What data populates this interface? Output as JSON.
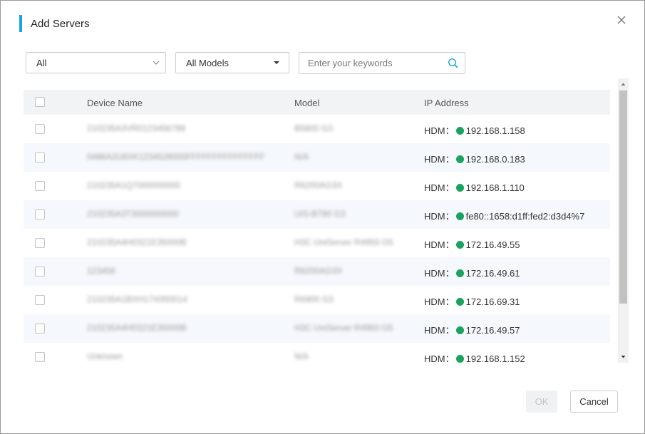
{
  "dialog": {
    "title": "Add Servers",
    "close_icon": "close-icon"
  },
  "filters": {
    "type_select": "All",
    "model_select": "All Models",
    "search_placeholder": "Enter your keywords",
    "search_value": ""
  },
  "table": {
    "headers": {
      "name": "Device Name",
      "model": "Model",
      "ip": "IP Address"
    },
    "rows": [
      {
        "name": "210235A3VR0123456789",
        "model": "B5800 G3",
        "ip_prefix": "HDM：",
        "ip": "192.168.1.158",
        "status": "green"
      },
      {
        "name": "0486A2U8XK1234528000FFFFFFFFFFFFFFF",
        "model": "N/A",
        "ip_prefix": "HDM：",
        "ip": "192.168.0.183",
        "status": "green"
      },
      {
        "name": "210235A1Q7000000000",
        "model": "R6200AG3X",
        "ip_prefix": "HDM：",
        "ip": "192.168.1.110",
        "status": "green"
      },
      {
        "name": "210235A3T3000000000",
        "model": "UIS-B790 G3",
        "ip_prefix": "HDM：",
        "ip": "fe80::1658:d1ff:fed2:d3d4%7",
        "status": "green"
      },
      {
        "name": "210235A4H0321E35000B",
        "model": "H3C UniServer R4950 G5",
        "ip_prefix": "HDM：",
        "ip": "172.16.49.55",
        "status": "green"
      },
      {
        "name": "123456",
        "model": "R6200AG3X",
        "ip_prefix": "HDM：",
        "ip": "172.16.49.61",
        "status": "green"
      },
      {
        "name": "210235A1BXH17X000014",
        "model": "R6900 G3",
        "ip_prefix": "HDM：",
        "ip": "172.16.69.31",
        "status": "green"
      },
      {
        "name": "210235A4H0321E35000B",
        "model": "H3C UniServer R4950 G5",
        "ip_prefix": "HDM：",
        "ip": "172.16.49.57",
        "status": "green"
      },
      {
        "name": "Unknown",
        "model": "N/A",
        "ip_prefix": "HDM：",
        "ip": "192.168.1.152",
        "status": "green"
      }
    ]
  },
  "footer": {
    "ok_label": "OK",
    "cancel_label": "Cancel"
  },
  "colors": {
    "accent": "#1aa3e8",
    "status_green": "#1aa360"
  }
}
